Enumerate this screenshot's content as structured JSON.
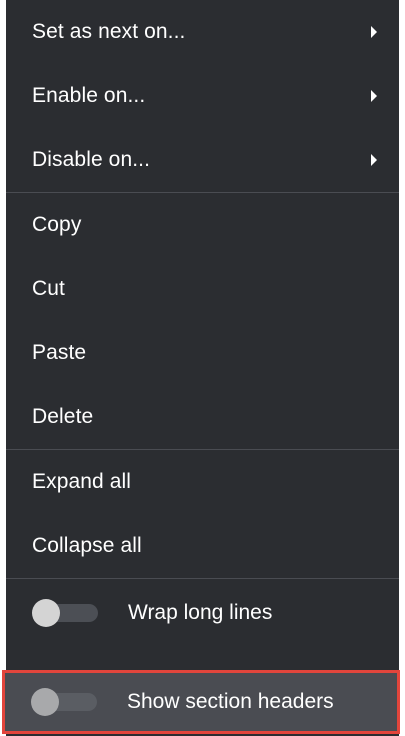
{
  "menu": {
    "submenu_items": [
      {
        "label": "Set as next on..."
      },
      {
        "label": "Enable on..."
      },
      {
        "label": "Disable on..."
      }
    ],
    "edit_items": [
      {
        "label": "Copy"
      },
      {
        "label": "Cut"
      },
      {
        "label": "Paste"
      },
      {
        "label": "Delete"
      }
    ],
    "view_items": [
      {
        "label": "Expand all"
      },
      {
        "label": "Collapse all"
      }
    ],
    "toggles": [
      {
        "label": "Wrap long lines",
        "on": false
      },
      {
        "label": "Show section headers",
        "on": false
      }
    ]
  },
  "colors": {
    "menu_background": "#2b2d31",
    "separator": "#4a4c52",
    "highlight_background": "#4a4c52",
    "highlight_border": "#e2453c",
    "text": "#ffffff"
  }
}
